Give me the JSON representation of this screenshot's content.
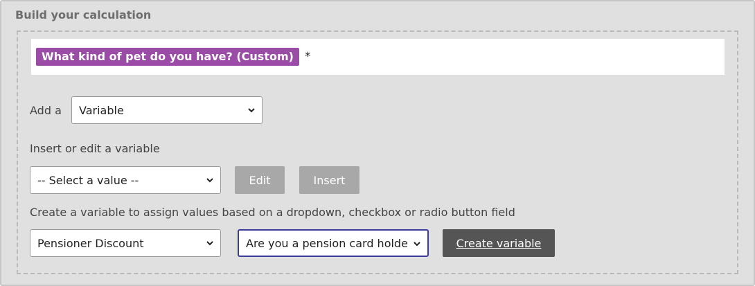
{
  "section_title": "Build your calculation",
  "formula": {
    "token_label": "What kind of pet do you have? (Custom)",
    "asterisk": "*"
  },
  "add": {
    "label": "Add a",
    "selected": "Variable"
  },
  "insert_edit": {
    "label": "Insert or edit a variable",
    "selected": "-- Select a value --",
    "edit_label": "Edit",
    "insert_label": "Insert"
  },
  "create": {
    "label": "Create a variable to assign values based on a dropdown, checkbox or radio button field",
    "variable_selected": "Pensioner Discount",
    "field_selected": "Are you a pension card holder?",
    "button_label": "Create variable"
  },
  "colors": {
    "token_bg": "#9a4ca6",
    "panel_bg": "#e0e0e0",
    "primary_button": "#555555",
    "disabled_button": "#a8a8a8",
    "focus_border": "#3b3b9c"
  }
}
